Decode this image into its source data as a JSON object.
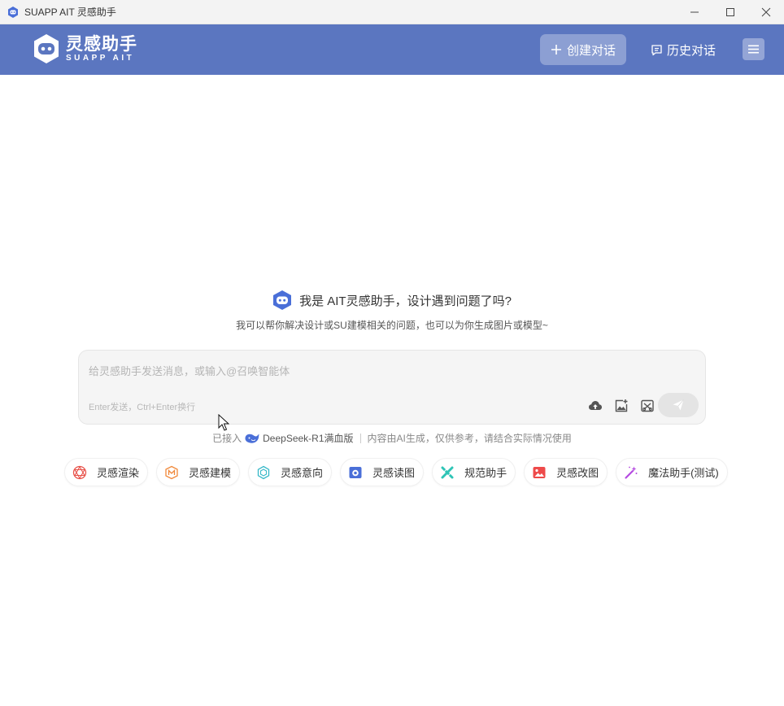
{
  "window": {
    "title": "SUAPP AIT 灵感助手"
  },
  "header": {
    "logo_cn": "灵感助手",
    "logo_en": "SUAPP AIT",
    "new_chat_label": "创建对话",
    "history_label": "历史对话"
  },
  "welcome": {
    "greeting": "我是 AIT灵感助手，设计遇到问题了吗?",
    "subtitle": "我可以帮你解决设计或SU建模相关的问题，也可以为你生成图片或模型~"
  },
  "input": {
    "placeholder": "给灵感助手发送消息，或输入@召唤智能体",
    "hint": "Enter发送，Ctrl+Enter换行"
  },
  "powered": {
    "prefix": "已接入",
    "model": "DeepSeek-R1满血版",
    "disclaimer": "内容由AI生成，仅供参考，请结合实际情况使用"
  },
  "chips": [
    {
      "label": "灵感渲染",
      "icon": "render-icon",
      "color": "#e8524a"
    },
    {
      "label": "灵感建模",
      "icon": "modeling-icon",
      "color": "#f0883a"
    },
    {
      "label": "灵感意向",
      "icon": "intent-icon",
      "color": "#35b8c8"
    },
    {
      "label": "灵感读图",
      "icon": "read-image-icon",
      "color": "#4a6fd8"
    },
    {
      "label": "规范助手",
      "icon": "standard-icon",
      "color": "#2ec4b6"
    },
    {
      "label": "灵感改图",
      "icon": "edit-image-icon",
      "color": "#ee4a4a"
    },
    {
      "label": "魔法助手(测试)",
      "icon": "magic-wand-icon",
      "color": "#b44ae0"
    }
  ],
  "colors": {
    "header_bg": "#5b76c0",
    "accent": "#4a6fd8"
  }
}
